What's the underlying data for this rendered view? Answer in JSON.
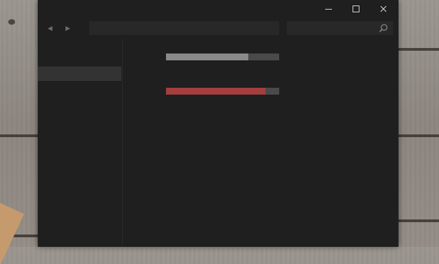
{
  "window": {
    "minimize_icon": "minimize-icon",
    "maximize_icon": "maximize-icon",
    "close_icon": "close-icon"
  },
  "toolbar": {
    "back_icon": "back-arrow-icon",
    "forward_icon": "forward-arrow-icon",
    "address_value": "",
    "search_value": "",
    "search_icon": "search-icon"
  },
  "sidebar": {
    "items": [
      {
        "label": "",
        "selected": true
      }
    ]
  },
  "drives": [
    {
      "usage_percent": 73,
      "color": "#8a8a8a"
    },
    {
      "usage_percent": 88,
      "color": "#a53e3e"
    }
  ],
  "colors": {
    "window_background": "#1f1f1f",
    "bar_track": "#4a4a4a",
    "drive_warning": "#a53e3e"
  }
}
